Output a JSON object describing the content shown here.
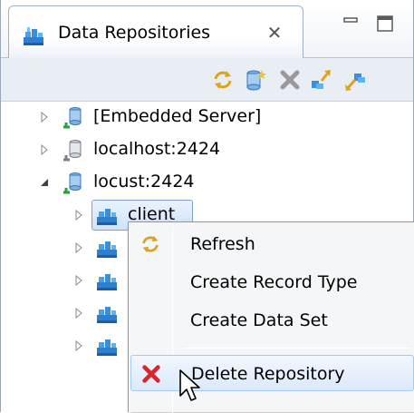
{
  "view": {
    "title": "Data Repositories",
    "close_glyph": "✕",
    "icon": "data-repositories-icon"
  },
  "toolbar": {
    "buttons": [
      {
        "name": "refresh-icon"
      },
      {
        "name": "new-repository-icon"
      },
      {
        "name": "delete-icon"
      },
      {
        "name": "import-icon"
      },
      {
        "name": "export-icon"
      }
    ]
  },
  "tree": {
    "nodes": [
      {
        "label": "[Embedded Server]",
        "expanded": false,
        "icon": "server-icon"
      },
      {
        "label": "localhost:2424",
        "expanded": false,
        "icon": "server-icon"
      },
      {
        "label": "locust:2424",
        "expanded": true,
        "icon": "server-icon"
      },
      {
        "label": "client",
        "expanded": false,
        "icon": "repository-icon",
        "selected": true
      }
    ]
  },
  "context_menu": {
    "items": [
      {
        "label": "Refresh",
        "icon": "refresh-icon"
      },
      {
        "label": "Create Record Type",
        "icon": ""
      },
      {
        "label": "Create Data Set",
        "icon": ""
      },
      {
        "label": "Delete Repository",
        "icon": "delete-icon",
        "hover": true
      }
    ]
  },
  "colors": {
    "selection": "#cfe3fa",
    "menu_bg": "#f5f6f7",
    "delete_red": "#d9262c",
    "accent_blue": "#2f6db5"
  }
}
